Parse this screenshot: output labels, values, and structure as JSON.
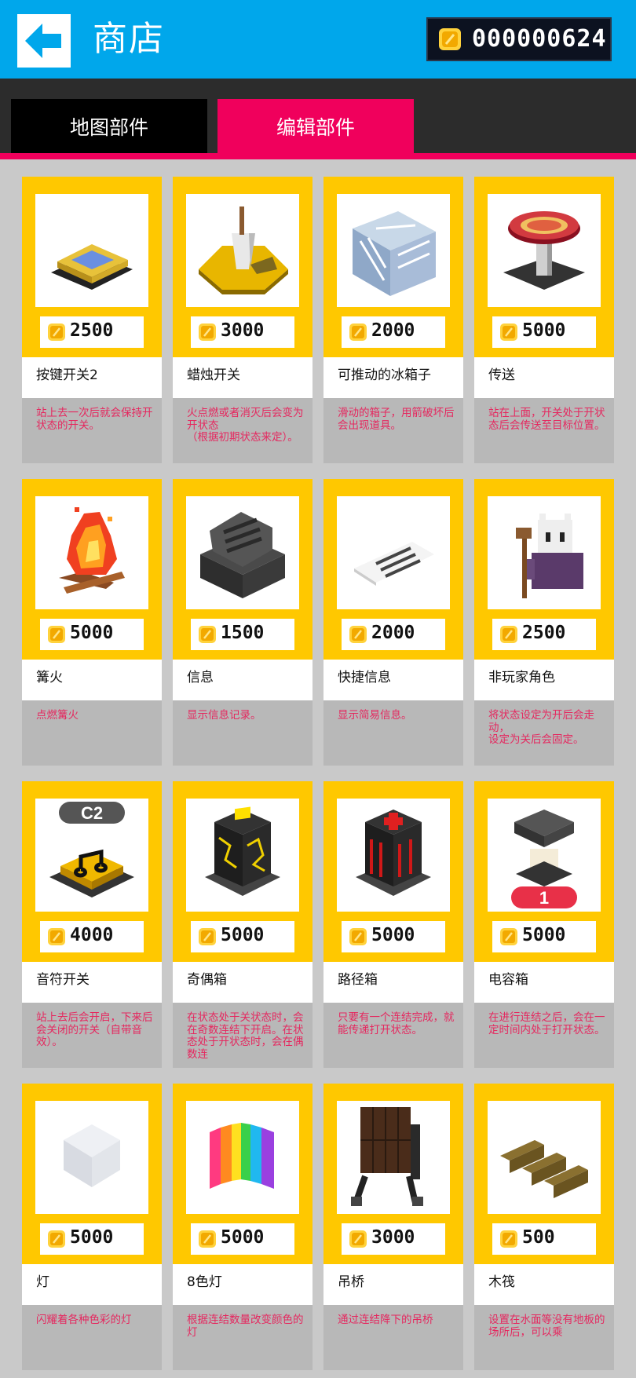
{
  "header": {
    "title": "商店",
    "coins": "000000624"
  },
  "tabs": [
    {
      "label": "地图部件",
      "active": false
    },
    {
      "label": "编辑部件",
      "active": true
    }
  ],
  "colors": {
    "header": "#00a7eb",
    "accent": "#f0005c",
    "card": "#ffc800",
    "desc_text": "#e5285f"
  },
  "items": [
    {
      "name": "按键开关2",
      "price": "2500",
      "desc": "站上去一次后就会保持开状态的开关。",
      "icon": "switch-pad-icon"
    },
    {
      "name": "蜡烛开关",
      "price": "3000",
      "desc": "火点燃或者消灭后会变为开状态\n（根据初期状态来定）。",
      "icon": "candle-icon"
    },
    {
      "name": "可推动的冰箱子",
      "price": "2000",
      "desc": "滑动的箱子，用箭破坏后会出现道具。",
      "icon": "ice-box-icon"
    },
    {
      "name": "传送",
      "price": "5000",
      "desc": "站在上面，开关处于开状态后会传送至目标位置。",
      "icon": "teleport-icon"
    },
    {
      "name": "篝火",
      "price": "5000",
      "desc": "点燃篝火",
      "icon": "bonfire-icon"
    },
    {
      "name": "信息",
      "price": "1500",
      "desc": "显示信息记录。",
      "icon": "message-block-icon"
    },
    {
      "name": "快捷信息",
      "price": "2000",
      "desc": "显示简易信息。",
      "icon": "quick-message-icon"
    },
    {
      "name": "非玩家角色",
      "price": "2500",
      "desc": "将状态设定为开后会走动，\n设定为关后会固定。",
      "icon": "npc-icon"
    },
    {
      "name": "音符开关",
      "price": "4000",
      "desc": "站上去后会开启，下来后会关闭的开关（自带音效）。",
      "icon": "note-switch-icon",
      "badge": "C2"
    },
    {
      "name": "奇偶箱",
      "price": "5000",
      "desc": "在状态处于关状态时，会在奇数连结下开启。在状态处于开状态时，会在偶数连",
      "icon": "parity-box-icon"
    },
    {
      "name": "路径箱",
      "price": "5000",
      "desc": "只要有一个连结完成，就能传递打开状态。",
      "icon": "path-box-icon"
    },
    {
      "name": "电容箱",
      "price": "5000",
      "desc": "在进行连结之后，会在一定时间内处于打开状态。",
      "icon": "capacitor-box-icon",
      "badge": "1"
    },
    {
      "name": "灯",
      "price": "5000",
      "desc": "闪耀着各种色彩的灯",
      "icon": "lamp-icon"
    },
    {
      "name": "8色灯",
      "price": "5000",
      "desc": "根据连结数量改变颜色的灯",
      "icon": "rainbow-lamp-icon"
    },
    {
      "name": "吊桥",
      "price": "3000",
      "desc": "通过连结降下的吊桥",
      "icon": "drawbridge-icon"
    },
    {
      "name": "木筏",
      "price": "500",
      "desc": "设置在水面等没有地板的场所后，可以乘",
      "icon": "raft-icon"
    }
  ]
}
